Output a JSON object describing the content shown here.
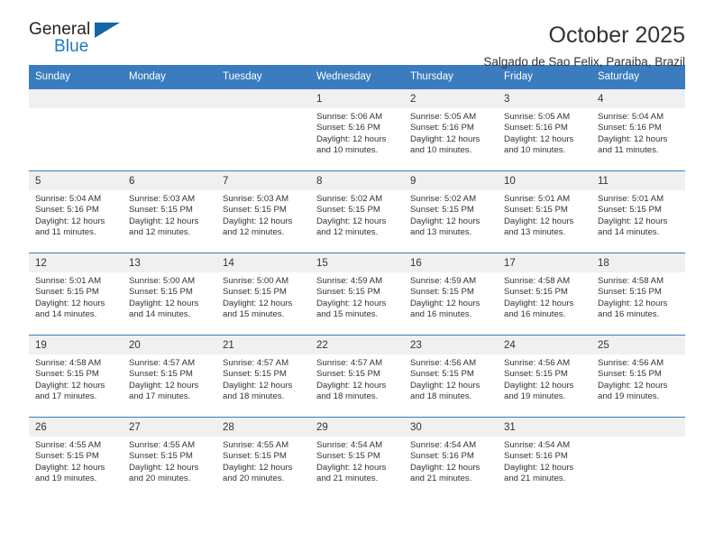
{
  "brand": {
    "word_one": "General",
    "word_two": "Blue",
    "triangle_color": "#1565a8",
    "blue_color": "#1f7ac0"
  },
  "header": {
    "month_title": "October 2025",
    "location": "Salgado de Sao Felix, Paraiba, Brazil"
  },
  "calendar": {
    "header_bg": "#3a7cbe",
    "daynum_bg": "#f0f0f0",
    "weekdays": [
      "Sunday",
      "Monday",
      "Tuesday",
      "Wednesday",
      "Thursday",
      "Friday",
      "Saturday"
    ],
    "weeks": [
      [
        {
          "day": "",
          "empty": true,
          "sunrise": "",
          "sunset": "",
          "daylight": ""
        },
        {
          "day": "",
          "empty": true,
          "sunrise": "",
          "sunset": "",
          "daylight": ""
        },
        {
          "day": "",
          "empty": true,
          "sunrise": "",
          "sunset": "",
          "daylight": ""
        },
        {
          "day": "1",
          "empty": false,
          "sunrise": "Sunrise: 5:06 AM",
          "sunset": "Sunset: 5:16 PM",
          "daylight": "Daylight: 12 hours and 10 minutes."
        },
        {
          "day": "2",
          "empty": false,
          "sunrise": "Sunrise: 5:05 AM",
          "sunset": "Sunset: 5:16 PM",
          "daylight": "Daylight: 12 hours and 10 minutes."
        },
        {
          "day": "3",
          "empty": false,
          "sunrise": "Sunrise: 5:05 AM",
          "sunset": "Sunset: 5:16 PM",
          "daylight": "Daylight: 12 hours and 10 minutes."
        },
        {
          "day": "4",
          "empty": false,
          "sunrise": "Sunrise: 5:04 AM",
          "sunset": "Sunset: 5:16 PM",
          "daylight": "Daylight: 12 hours and 11 minutes."
        }
      ],
      [
        {
          "day": "5",
          "empty": false,
          "sunrise": "Sunrise: 5:04 AM",
          "sunset": "Sunset: 5:16 PM",
          "daylight": "Daylight: 12 hours and 11 minutes."
        },
        {
          "day": "6",
          "empty": false,
          "sunrise": "Sunrise: 5:03 AM",
          "sunset": "Sunset: 5:15 PM",
          "daylight": "Daylight: 12 hours and 12 minutes."
        },
        {
          "day": "7",
          "empty": false,
          "sunrise": "Sunrise: 5:03 AM",
          "sunset": "Sunset: 5:15 PM",
          "daylight": "Daylight: 12 hours and 12 minutes."
        },
        {
          "day": "8",
          "empty": false,
          "sunrise": "Sunrise: 5:02 AM",
          "sunset": "Sunset: 5:15 PM",
          "daylight": "Daylight: 12 hours and 12 minutes."
        },
        {
          "day": "9",
          "empty": false,
          "sunrise": "Sunrise: 5:02 AM",
          "sunset": "Sunset: 5:15 PM",
          "daylight": "Daylight: 12 hours and 13 minutes."
        },
        {
          "day": "10",
          "empty": false,
          "sunrise": "Sunrise: 5:01 AM",
          "sunset": "Sunset: 5:15 PM",
          "daylight": "Daylight: 12 hours and 13 minutes."
        },
        {
          "day": "11",
          "empty": false,
          "sunrise": "Sunrise: 5:01 AM",
          "sunset": "Sunset: 5:15 PM",
          "daylight": "Daylight: 12 hours and 14 minutes."
        }
      ],
      [
        {
          "day": "12",
          "empty": false,
          "sunrise": "Sunrise: 5:01 AM",
          "sunset": "Sunset: 5:15 PM",
          "daylight": "Daylight: 12 hours and 14 minutes."
        },
        {
          "day": "13",
          "empty": false,
          "sunrise": "Sunrise: 5:00 AM",
          "sunset": "Sunset: 5:15 PM",
          "daylight": "Daylight: 12 hours and 14 minutes."
        },
        {
          "day": "14",
          "empty": false,
          "sunrise": "Sunrise: 5:00 AM",
          "sunset": "Sunset: 5:15 PM",
          "daylight": "Daylight: 12 hours and 15 minutes."
        },
        {
          "day": "15",
          "empty": false,
          "sunrise": "Sunrise: 4:59 AM",
          "sunset": "Sunset: 5:15 PM",
          "daylight": "Daylight: 12 hours and 15 minutes."
        },
        {
          "day": "16",
          "empty": false,
          "sunrise": "Sunrise: 4:59 AM",
          "sunset": "Sunset: 5:15 PM",
          "daylight": "Daylight: 12 hours and 16 minutes."
        },
        {
          "day": "17",
          "empty": false,
          "sunrise": "Sunrise: 4:58 AM",
          "sunset": "Sunset: 5:15 PM",
          "daylight": "Daylight: 12 hours and 16 minutes."
        },
        {
          "day": "18",
          "empty": false,
          "sunrise": "Sunrise: 4:58 AM",
          "sunset": "Sunset: 5:15 PM",
          "daylight": "Daylight: 12 hours and 16 minutes."
        }
      ],
      [
        {
          "day": "19",
          "empty": false,
          "sunrise": "Sunrise: 4:58 AM",
          "sunset": "Sunset: 5:15 PM",
          "daylight": "Daylight: 12 hours and 17 minutes."
        },
        {
          "day": "20",
          "empty": false,
          "sunrise": "Sunrise: 4:57 AM",
          "sunset": "Sunset: 5:15 PM",
          "daylight": "Daylight: 12 hours and 17 minutes."
        },
        {
          "day": "21",
          "empty": false,
          "sunrise": "Sunrise: 4:57 AM",
          "sunset": "Sunset: 5:15 PM",
          "daylight": "Daylight: 12 hours and 18 minutes."
        },
        {
          "day": "22",
          "empty": false,
          "sunrise": "Sunrise: 4:57 AM",
          "sunset": "Sunset: 5:15 PM",
          "daylight": "Daylight: 12 hours and 18 minutes."
        },
        {
          "day": "23",
          "empty": false,
          "sunrise": "Sunrise: 4:56 AM",
          "sunset": "Sunset: 5:15 PM",
          "daylight": "Daylight: 12 hours and 18 minutes."
        },
        {
          "day": "24",
          "empty": false,
          "sunrise": "Sunrise: 4:56 AM",
          "sunset": "Sunset: 5:15 PM",
          "daylight": "Daylight: 12 hours and 19 minutes."
        },
        {
          "day": "25",
          "empty": false,
          "sunrise": "Sunrise: 4:56 AM",
          "sunset": "Sunset: 5:15 PM",
          "daylight": "Daylight: 12 hours and 19 minutes."
        }
      ],
      [
        {
          "day": "26",
          "empty": false,
          "sunrise": "Sunrise: 4:55 AM",
          "sunset": "Sunset: 5:15 PM",
          "daylight": "Daylight: 12 hours and 19 minutes."
        },
        {
          "day": "27",
          "empty": false,
          "sunrise": "Sunrise: 4:55 AM",
          "sunset": "Sunset: 5:15 PM",
          "daylight": "Daylight: 12 hours and 20 minutes."
        },
        {
          "day": "28",
          "empty": false,
          "sunrise": "Sunrise: 4:55 AM",
          "sunset": "Sunset: 5:15 PM",
          "daylight": "Daylight: 12 hours and 20 minutes."
        },
        {
          "day": "29",
          "empty": false,
          "sunrise": "Sunrise: 4:54 AM",
          "sunset": "Sunset: 5:15 PM",
          "daylight": "Daylight: 12 hours and 21 minutes."
        },
        {
          "day": "30",
          "empty": false,
          "sunrise": "Sunrise: 4:54 AM",
          "sunset": "Sunset: 5:16 PM",
          "daylight": "Daylight: 12 hours and 21 minutes."
        },
        {
          "day": "31",
          "empty": false,
          "sunrise": "Sunrise: 4:54 AM",
          "sunset": "Sunset: 5:16 PM",
          "daylight": "Daylight: 12 hours and 21 minutes."
        },
        {
          "day": "",
          "empty": true,
          "sunrise": "",
          "sunset": "",
          "daylight": ""
        }
      ]
    ]
  }
}
